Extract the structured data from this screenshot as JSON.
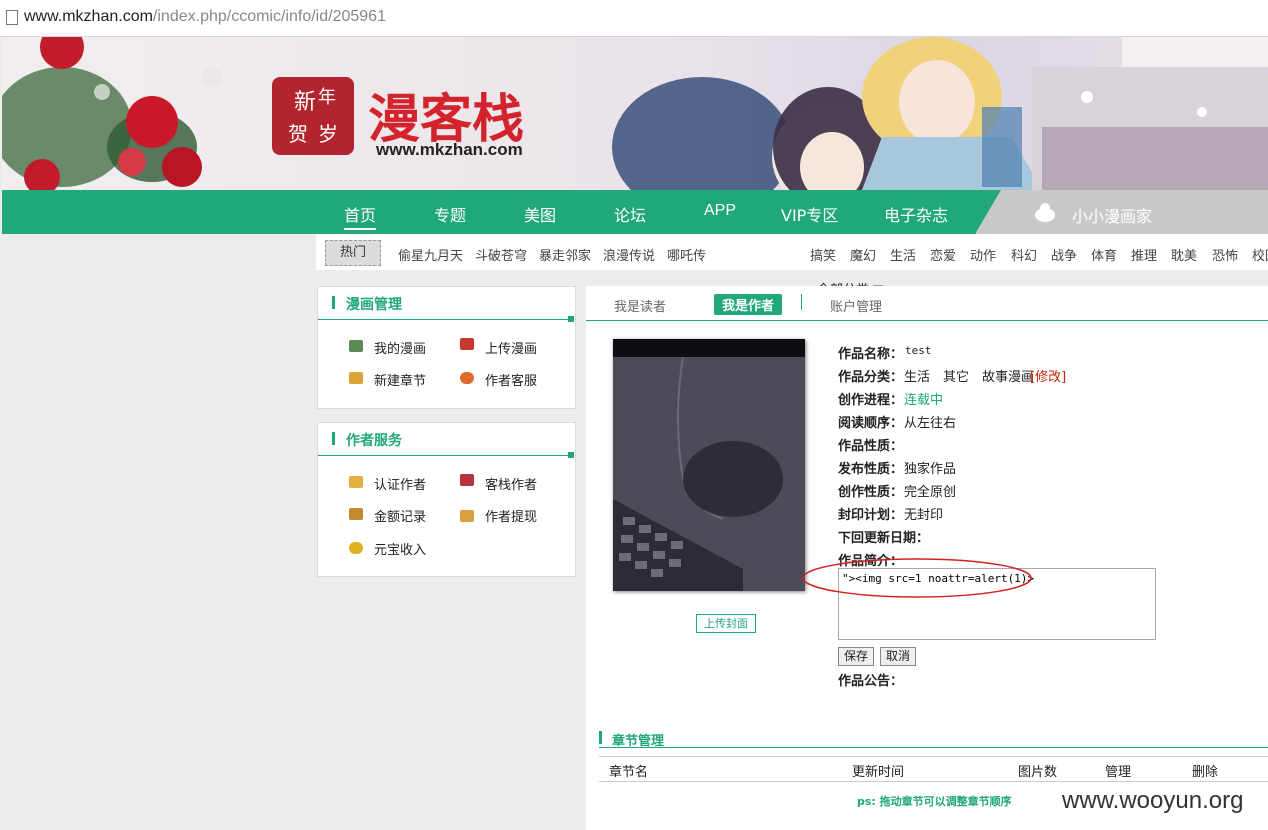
{
  "address_bar": {
    "url_host": "www.mkzhan.com",
    "url_path": "/index.php/ccomic/info/id/205961"
  },
  "logo": {
    "stamp_chars": [
      "新",
      "年",
      "贺",
      "岁"
    ],
    "brand": "漫客栈",
    "domain": "www.mkzhan.com"
  },
  "nav": {
    "items": [
      "首页",
      "专题",
      "美图",
      "论坛",
      "APP",
      "VIP专区",
      "电子杂志"
    ],
    "active": "首页",
    "user_name": "小小漫画家"
  },
  "subnav": {
    "hot_label": "热门",
    "hot_titles": [
      "偷星九月天",
      "斗破苍穹",
      "暴走邻家",
      "浪漫传说",
      "哪吒传"
    ],
    "genres": [
      "搞笑",
      "魔幻",
      "生活",
      "恋爱",
      "动作",
      "科幻",
      "战争",
      "体育",
      "推理",
      "耽美",
      "恐怖",
      "校园"
    ],
    "all_categories": "全部分类 ▼"
  },
  "comic_manage": {
    "title": "漫画管理",
    "links": [
      "我的漫画",
      "上传漫画",
      "新建章节",
      "作者客服"
    ]
  },
  "author_service": {
    "title": "作者服务",
    "links": [
      "认证作者",
      "客栈作者",
      "金额记录",
      "作者提现",
      "元宝收入"
    ]
  },
  "tabs": {
    "reader": "我是读者",
    "author": "我是作者",
    "account": "账户管理"
  },
  "upload_cover": "上传封面",
  "work_info": {
    "name_label": "作品名称：",
    "name_value": "test",
    "category_label": "作品分类：",
    "category_value": "生活　其它　故事漫画",
    "category_edit": "[修改]",
    "progress_label": "创作进程：",
    "progress_value": "连载中",
    "reading_label": "阅读顺序：",
    "reading_value": "从左往右",
    "nature_label": "作品性质：",
    "publish_label": "发布性质：",
    "publish_value": "独家作品",
    "creation_label": "创作性质：",
    "creation_value": "完全原创",
    "seal_label": "封印计划：",
    "seal_value": "无封印",
    "next_update_label": "下回更新日期：",
    "intro_label": "作品简介：",
    "intro_value": "\"><img src=1 noattr=alert(1)>",
    "save_label": "保存",
    "cancel_label": "取消",
    "notice_label": "作品公告："
  },
  "chapters": {
    "title": "章节管理",
    "columns": [
      "章节名",
      "更新时间",
      "图片数",
      "管理",
      "删除"
    ],
    "tip": "ps: 拖动章节可以调整章节顺序"
  },
  "watermark": "www.wooyun.org",
  "colors": {
    "accent": "#20a77a",
    "edit_red": "#cc2200",
    "annotation_red": "#d42020"
  }
}
